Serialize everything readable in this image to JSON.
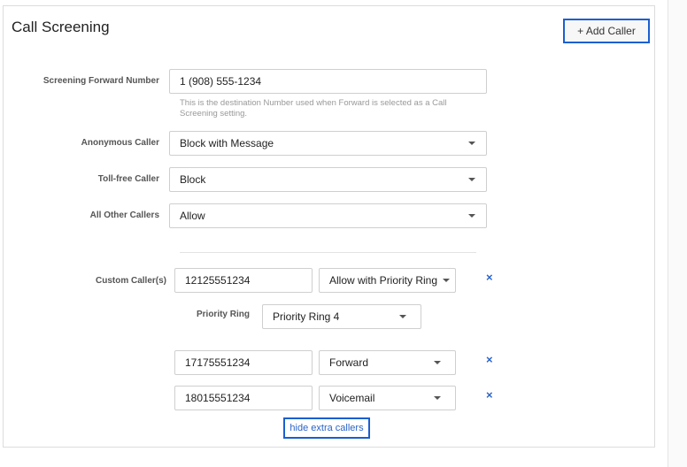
{
  "panel": {
    "title": "Call Screening",
    "add_caller_label": "+ Add Caller"
  },
  "forward": {
    "label": "Screening Forward Number",
    "value": "1 (908) 555-1234",
    "help": "This is the destination Number used when Forward is selected as a Call Screening setting."
  },
  "anonymous": {
    "label": "Anonymous Caller",
    "value": "Block with Message"
  },
  "tollfree": {
    "label": "Toll-free Caller",
    "value": "Block"
  },
  "others": {
    "label": "All Other Callers",
    "value": "Allow"
  },
  "custom": {
    "label": "Custom Caller(s)",
    "callers": [
      {
        "number": "12125551234",
        "action": "Allow with Priority Ring",
        "remove": "×"
      },
      {
        "number": "17175551234",
        "action": "Forward",
        "remove": "×"
      },
      {
        "number": "18015551234",
        "action": "Voicemail",
        "remove": "×"
      }
    ],
    "priority_label": "Priority Ring",
    "priority_value": "Priority Ring 4",
    "hide_link": "hide extra callers"
  }
}
